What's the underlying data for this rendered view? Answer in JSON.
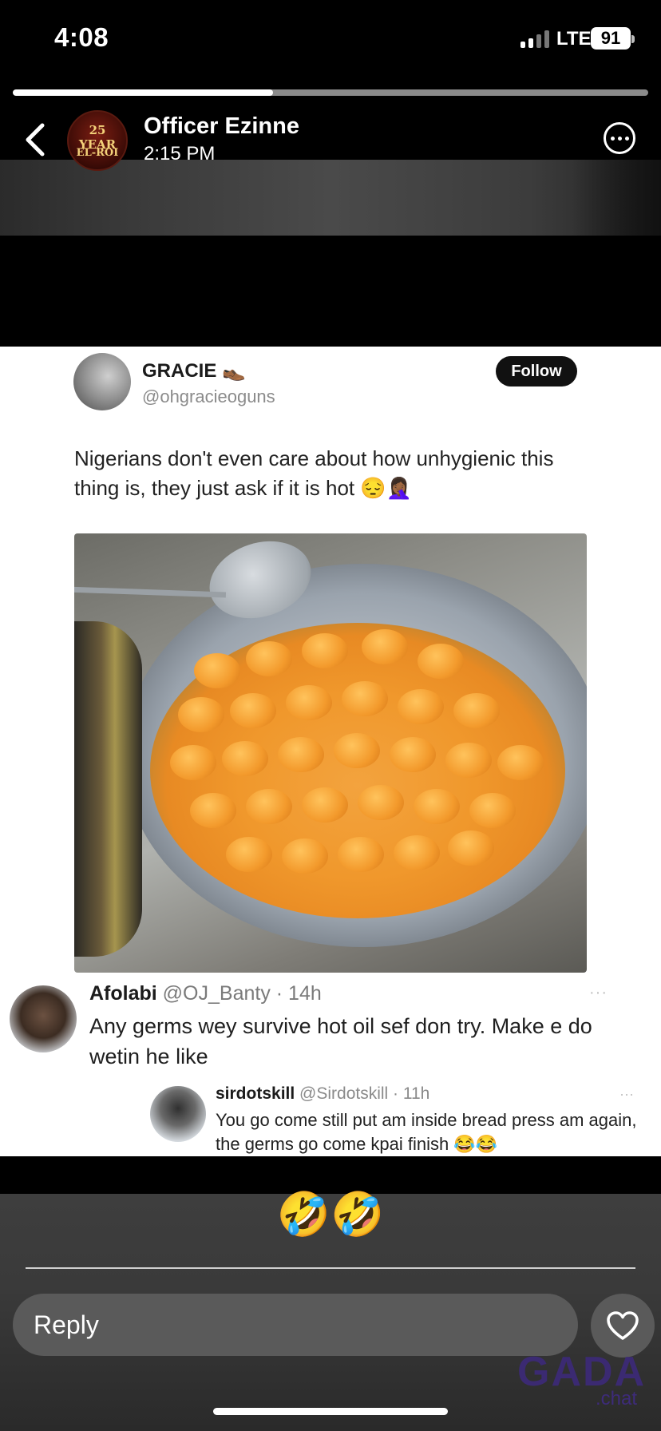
{
  "status_bar": {
    "time": "4:08",
    "network": "LTE",
    "battery": "91"
  },
  "story_progress": {
    "fraction": 0.41
  },
  "header": {
    "user_name": "Officer Ezinne",
    "post_time": "2:15 PM",
    "avatar_text_top": "25 YEAR",
    "avatar_text_bottom": "EL-ROI"
  },
  "tweet": {
    "name": "GRACIE 👞",
    "handle": "@ohgracieoguns",
    "follow_label": "Follow",
    "text": "Nigerians don't even care about how unhygienic this thing is, they just ask if it is hot 😔🤦🏾‍♀️"
  },
  "comments": [
    {
      "name": "Afolabi",
      "handle_time": "@OJ_Banty · 14h",
      "text": "Any germs wey survive hot oil sef don try. Make e do wetin he like",
      "more": "···"
    },
    {
      "name": "sirdotskill",
      "handle_time": "@Sirdotskill · 11h",
      "text": "You go come still put am inside bread press am again, the germs go come kpai finish 😂😂",
      "more": "···"
    }
  ],
  "caption": "🤣🤣",
  "reply": {
    "placeholder": "Reply"
  },
  "watermark": {
    "main": "GADA",
    "sub": ".chat"
  },
  "icons": {
    "back": "chevron-left-icon",
    "more": "ellipsis-circle-icon",
    "like": "heart-icon"
  },
  "colors": {
    "background": "#000000",
    "footer": "#3c3c3c",
    "progress_track": "#8a8a8a",
    "progress_fill": "#ffffff"
  }
}
